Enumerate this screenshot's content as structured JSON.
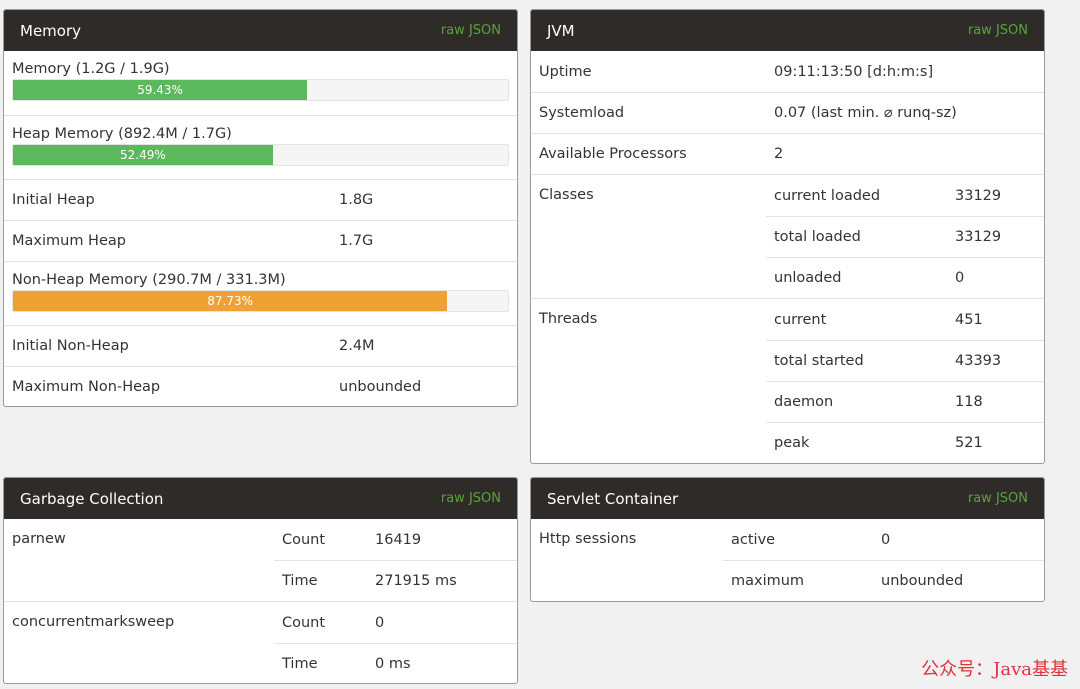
{
  "memory": {
    "title": "Memory",
    "raw_json": "raw JSON",
    "bars": [
      {
        "label": "Memory (1.2G / 1.9G)",
        "percent_text": "59.43%",
        "percent": 59.43,
        "color": "#5cb85c"
      },
      {
        "label": "Heap Memory (892.4M / 1.7G)",
        "percent_text": "52.49%",
        "percent": 52.49,
        "color": "#5cb85c"
      },
      {
        "label": "Non-Heap Memory (290.7M / 331.3M)",
        "percent_text": "87.73%",
        "percent": 87.73,
        "color": "#f0a034"
      }
    ],
    "initial_heap": {
      "label": "Initial Heap",
      "value": "1.8G"
    },
    "maximum_heap": {
      "label": "Maximum Heap",
      "value": "1.7G"
    },
    "initial_non_heap": {
      "label": "Initial Non-Heap",
      "value": "2.4M"
    },
    "maximum_non_heap": {
      "label": "Maximum Non-Heap",
      "value": "unbounded"
    }
  },
  "jvm": {
    "title": "JVM",
    "raw_json": "raw JSON",
    "uptime": {
      "label": "Uptime",
      "value": "09:11:13:50 [d:h:m:s]"
    },
    "systemload": {
      "label": "Systemload",
      "value": "0.07 (last min. ⌀ runq-sz)"
    },
    "processors": {
      "label": "Available Processors",
      "value": "2"
    },
    "classes": {
      "label": "Classes",
      "rows": [
        {
          "key": "current loaded",
          "value": "33129"
        },
        {
          "key": "total loaded",
          "value": "33129"
        },
        {
          "key": "unloaded",
          "value": "0"
        }
      ]
    },
    "threads": {
      "label": "Threads",
      "rows": [
        {
          "key": "current",
          "value": "451"
        },
        {
          "key": "total started",
          "value": "43393"
        },
        {
          "key": "daemon",
          "value": "118"
        },
        {
          "key": "peak",
          "value": "521"
        }
      ]
    }
  },
  "gc": {
    "title": "Garbage Collection",
    "raw_json": "raw JSON",
    "collectors": [
      {
        "name": "parnew",
        "rows": [
          {
            "key": "Count",
            "value": "16419"
          },
          {
            "key": "Time",
            "value": "271915 ms"
          }
        ]
      },
      {
        "name": "concurrentmarksweep",
        "rows": [
          {
            "key": "Count",
            "value": "0"
          },
          {
            "key": "Time",
            "value": "0 ms"
          }
        ]
      }
    ]
  },
  "servlet": {
    "title": "Servlet Container",
    "raw_json": "raw JSON",
    "sessions": {
      "label": "Http sessions",
      "rows": [
        {
          "key": "active",
          "value": "0"
        },
        {
          "key": "maximum",
          "value": "unbounded"
        }
      ]
    }
  },
  "watermark": "公众号：Java基基"
}
